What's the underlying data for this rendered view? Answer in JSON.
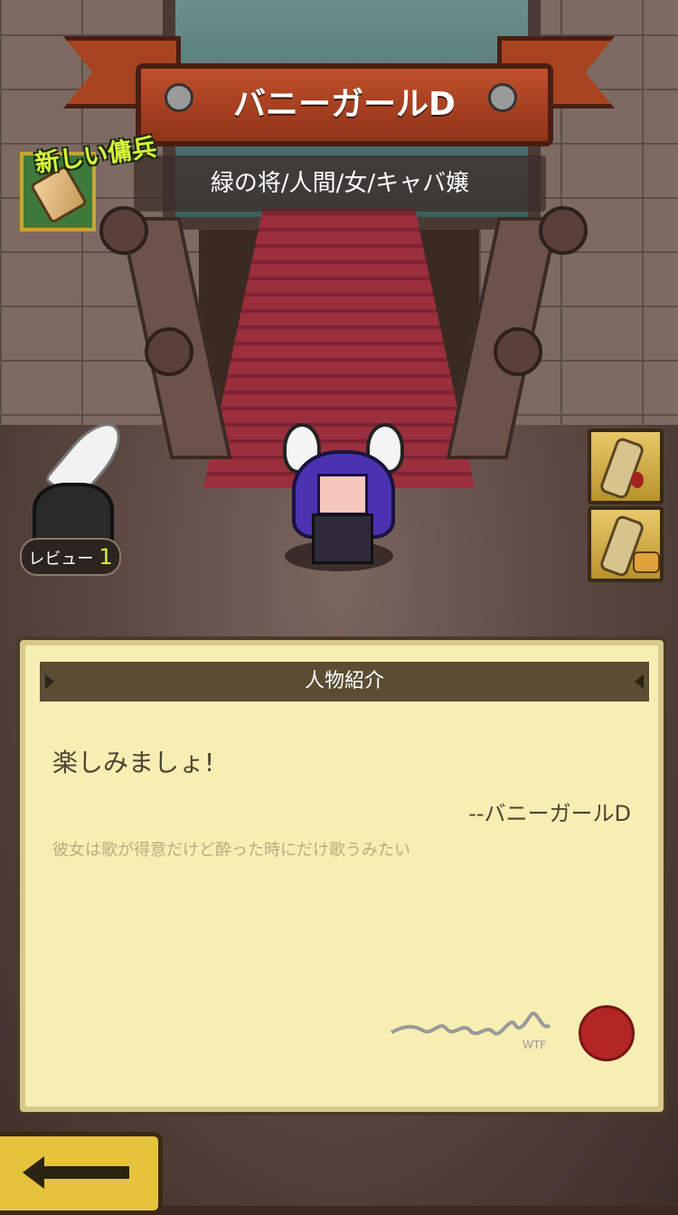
{
  "header": {
    "character_name": "バニーガールD",
    "subtitle": "緑の将/人間/女/キャバ嬢"
  },
  "badges": {
    "new_mercenary": "新しい傭兵"
  },
  "review": {
    "label": "レビュー",
    "count": "1"
  },
  "profile": {
    "section_title": "人物紹介",
    "quote": "楽しみましょ!",
    "author": "--バニーガールD",
    "description": "彼女は歌が得意だけど酔った時にだけ歌うみたい",
    "signature_suffix": "WTF"
  },
  "icons": {
    "back": "back-arrow-icon",
    "pipe_blood": "pipe-blood-icon",
    "pipe_handshake": "pipe-handshake-icon",
    "inkwell": "inkwell-quill-icon",
    "scroll": "scroll-icon",
    "seal": "wax-seal-icon"
  },
  "colors": {
    "banner": "#a7441f",
    "panel_bg": "#f7eeb3",
    "panel_header": "#5a4d33",
    "accent_green": "#d8f33a",
    "back_button": "#e5c33c"
  }
}
